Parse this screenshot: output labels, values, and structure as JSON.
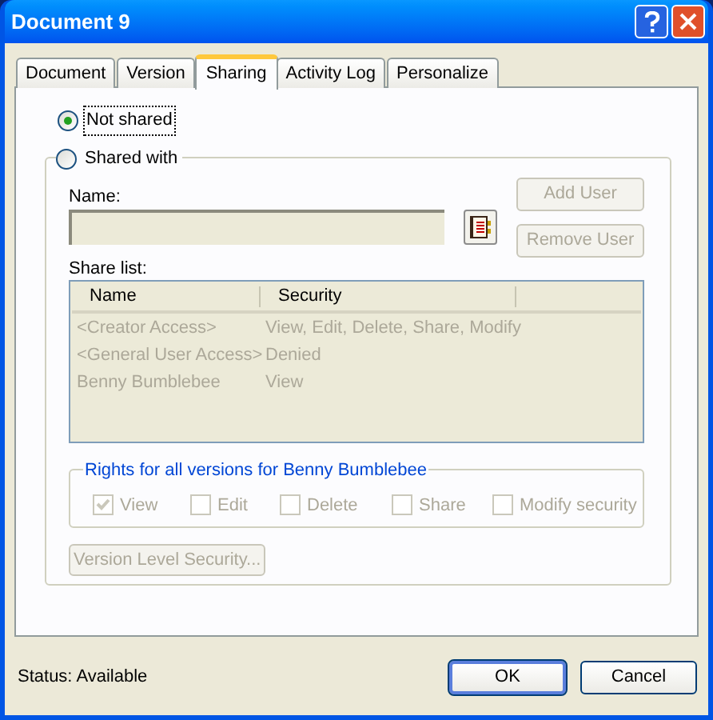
{
  "window": {
    "title": "Document 9"
  },
  "tabs": [
    {
      "label": "Document",
      "selected": false
    },
    {
      "label": "Version",
      "selected": false
    },
    {
      "label": "Sharing",
      "selected": true
    },
    {
      "label": "Activity Log",
      "selected": false
    },
    {
      "label": "Personalize",
      "selected": false
    }
  ],
  "sharing_options": [
    {
      "label": "Not shared",
      "selected": true
    },
    {
      "label": "Shared with",
      "selected": false
    }
  ],
  "name_field": {
    "label": "Name:",
    "disabled": true
  },
  "user_buttons": [
    {
      "label": "Add User",
      "disabled": true
    },
    {
      "label": "Remove User",
      "disabled": true
    }
  ],
  "share_list": {
    "label": "Share list:",
    "disabled": true,
    "columns": [
      "Name",
      "Security"
    ],
    "rows": [
      [
        "<Creator Access>",
        "View, Edit, Delete, Share, Modify"
      ],
      [
        "<General User Access>",
        "Denied"
      ],
      [
        "Benny Bumblebee",
        "View"
      ]
    ]
  },
  "rights": {
    "title": "Rights for all versions for Benny Bumblebee",
    "items": [
      {
        "label": "View",
        "checked": true,
        "disabled": true
      },
      {
        "label": "Edit",
        "checked": false,
        "disabled": true
      },
      {
        "label": "Delete",
        "checked": false,
        "disabled": true
      },
      {
        "label": "Share",
        "checked": false,
        "disabled": true
      },
      {
        "label": "Modify security",
        "checked": false,
        "disabled": true
      }
    ]
  },
  "version_button": {
    "label": "Version Level Security...",
    "disabled": true
  },
  "status_bar": "Status: Available",
  "dialog_buttons": [
    {
      "label": "OK",
      "default": true
    },
    {
      "label": "Cancel",
      "default": false
    }
  ]
}
